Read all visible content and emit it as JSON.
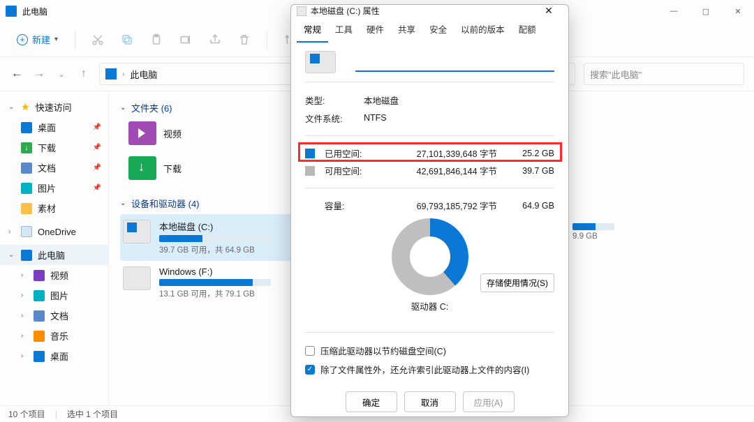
{
  "explorer": {
    "title": "此电脑",
    "toolbar": {
      "new_label": "新建"
    },
    "nav": {
      "address": "此电脑",
      "search_placeholder": "搜索\"此电脑\""
    },
    "sidebar": {
      "quick_access": "快速访问",
      "desktop": "桌面",
      "downloads": "下载",
      "documents": "文档",
      "pictures": "图片",
      "materials": "素材",
      "onedrive": "OneDrive",
      "this_pc": "此电脑",
      "videos": "视频",
      "pictures2": "图片",
      "documents2": "文档",
      "music": "音乐",
      "desktop2": "桌面"
    },
    "content": {
      "folders_header": "文件夹 (6)",
      "video": "视频",
      "downloads": "下载",
      "devices_header": "设备和驱动器 (4)",
      "drive_c": {
        "name": "本地磁盘 (C:)",
        "sub": "39.7 GB 可用，共 64.9 GB",
        "pct": 39
      },
      "drive_f": {
        "name": "Windows (F:)",
        "sub": "13.1 GB 可用，共 79.1 GB",
        "pct": 84
      },
      "hidden_drive_sub": "9.9 GB"
    },
    "status": {
      "items": "10 个项目",
      "selected": "选中 1 个项目"
    }
  },
  "dialog": {
    "title": "本地磁盘 (C:) 属性",
    "tabs": [
      "常规",
      "工具",
      "硬件",
      "共享",
      "安全",
      "以前的版本",
      "配额"
    ],
    "active_tab": 0,
    "type_label": "类型:",
    "type_value": "本地磁盘",
    "fs_label": "文件系统:",
    "fs_value": "NTFS",
    "used_label": "已用空间:",
    "used_bytes": "27,101,339,648 字节",
    "used_gb": "25.2 GB",
    "free_label": "可用空间:",
    "free_bytes": "42,691,846,144 字节",
    "free_gb": "39.7 GB",
    "cap_label": "容量:",
    "cap_bytes": "69,793,185,792 字节",
    "cap_gb": "64.9 GB",
    "drive_label": "驱动器 C:",
    "storage_btn": "存储使用情况(S)",
    "compress": "压缩此驱动器以节约磁盘空间(C)",
    "index": "除了文件属性外，还允许索引此驱动器上文件的内容(I)",
    "ok": "确定",
    "cancel": "取消",
    "apply": "应用(A)"
  },
  "chart_data": {
    "type": "pie",
    "title": "驱动器 C:",
    "series": [
      {
        "name": "已用空间",
        "value": 25.2,
        "unit": "GB",
        "bytes": 27101339648,
        "color": "#0a78d4"
      },
      {
        "name": "可用空间",
        "value": 39.7,
        "unit": "GB",
        "bytes": 42691846144,
        "color": "#bfbfbf"
      }
    ],
    "total": {
      "name": "容量",
      "value": 64.9,
      "unit": "GB",
      "bytes": 69793185792
    }
  }
}
